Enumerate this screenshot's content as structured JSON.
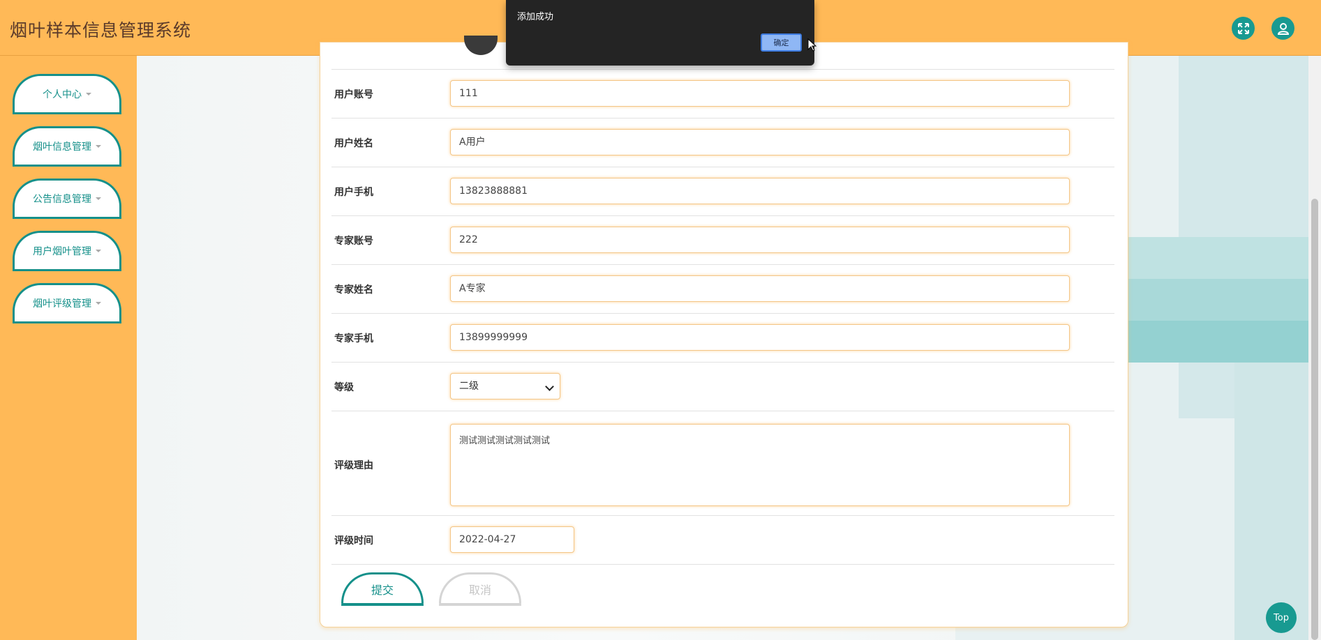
{
  "app": {
    "title": "烟叶样本信息管理系统"
  },
  "header": {
    "fullscreen_icon": "fullscreen-icon",
    "user_icon": "user-icon"
  },
  "sidebar": {
    "items": [
      {
        "label": "个人中心"
      },
      {
        "label": "烟叶信息管理"
      },
      {
        "label": "公告信息管理"
      },
      {
        "label": "用户烟叶管理"
      },
      {
        "label": "烟叶评级管理"
      }
    ]
  },
  "form": {
    "user_account": {
      "label": "用户账号",
      "value": "111"
    },
    "user_name": {
      "label": "用户姓名",
      "value": "A用户"
    },
    "user_phone": {
      "label": "用户手机",
      "value": "13823888881"
    },
    "expert_account": {
      "label": "专家账号",
      "value": "222"
    },
    "expert_name": {
      "label": "专家姓名",
      "value": "A专家"
    },
    "expert_phone": {
      "label": "专家手机",
      "value": "13899999999"
    },
    "grade": {
      "label": "等级",
      "value": "二级"
    },
    "reason": {
      "label": "评级理由",
      "value": "测试测试测试测试测试"
    },
    "rating_time": {
      "label": "评级时间",
      "value": "2022-04-27"
    },
    "submit_label": "提交",
    "cancel_label": "取消"
  },
  "dialog": {
    "message": "添加成功",
    "ok_label": "确定"
  },
  "top_button": {
    "label": "Top"
  },
  "colors": {
    "header_bg": "#ffb957",
    "accent": "#15908a",
    "dialog_bg": "#242424"
  }
}
